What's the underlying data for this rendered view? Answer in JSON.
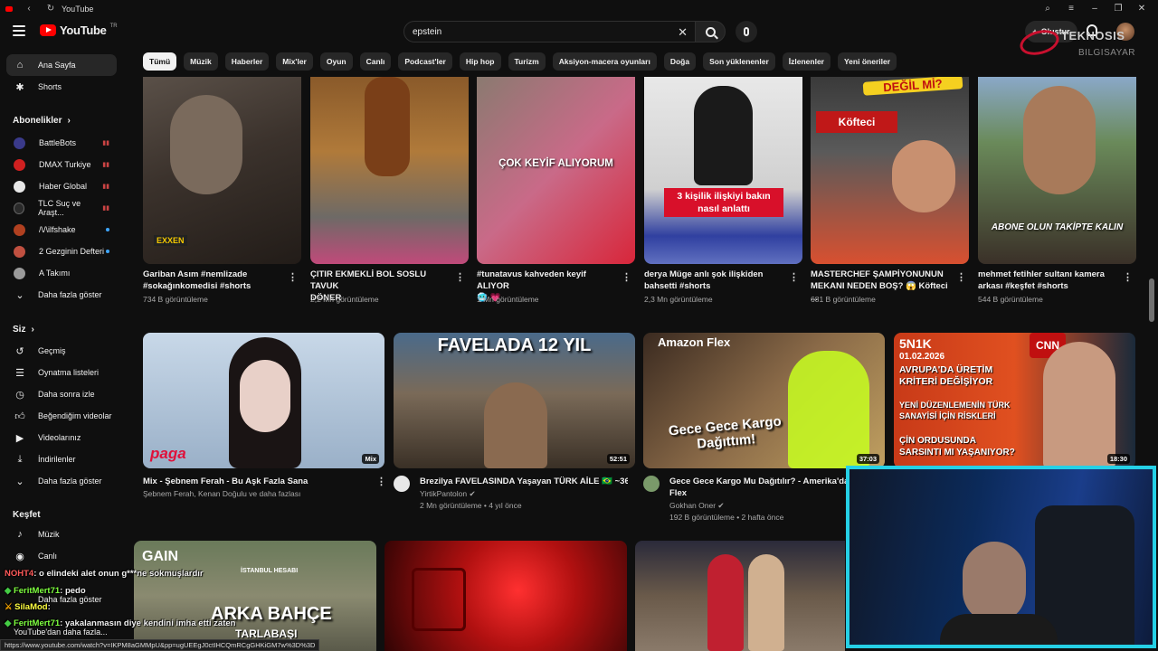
{
  "window": {
    "title": "YouTube"
  },
  "header": {
    "logo_text": "YouTube",
    "logo_region": "TR",
    "search_value": "epstein",
    "create_label": "Oluştur",
    "watermark_line1": "TEKNOSIS",
    "watermark_line2": "BILGISAYAR"
  },
  "sidebar": {
    "home": "Ana Sayfa",
    "shorts": "Shorts",
    "subs_header": "Abonelikler",
    "subscriptions": [
      {
        "name": "BattleBots",
        "color": "#3a3a8a"
      },
      {
        "name": "DMAX Turkiye",
        "color": "#d02020"
      },
      {
        "name": "Haber Global",
        "color": "#e8e8e8"
      },
      {
        "name": "TLC Suç ve Araşt...",
        "color": "#2a2a2a"
      },
      {
        "name": "/\\/\\ilfshake",
        "color": "#b04020"
      },
      {
        "name": "2 Gezginin Defteri",
        "color": "#c05040"
      },
      {
        "name": "A Takımı",
        "color": "#9a9a9a"
      }
    ],
    "subs_more": "Daha fazla göster",
    "you_header": "Siz",
    "you_items": [
      "Geçmiş",
      "Oynatma listeleri",
      "Daha sonra izle",
      "Beğendiğim videolar",
      "Videolarınız",
      "İndirilenler"
    ],
    "you_more": "Daha fazla göster",
    "explore_header": "Keşfet",
    "explore_items": [
      "Müzik",
      "Canlı"
    ],
    "explore_more": "Daha fazla göster",
    "explore_more2": "YouTube'dan daha fazla..."
  },
  "chips": [
    "Tümü",
    "Müzik",
    "Haberler",
    "Mix'ler",
    "Oyun",
    "Canlı",
    "Podcast'ler",
    "Hip hop",
    "Turizm",
    "Aksiyon-macera oyunları",
    "Doğa",
    "Son yüklenenler",
    "İzlenenler",
    "Yeni öneriler"
  ],
  "shorts": [
    {
      "title1": "Gariban Asım #nemlizade",
      "title2": "#sokağınkomedisi #shorts",
      "views": "734 B görüntüleme",
      "overlay": "EXXEN"
    },
    {
      "title1": "ÇITIR EKMEKLİ BOL SOSLU TAVUK",
      "title2": "DÖNER",
      "views": "2,2 Mn görüntüleme",
      "overlay": ""
    },
    {
      "title1": "#tunatavus kahveden keyif ALIYOR",
      "title2": "🥶 💗",
      "views": "1 Mn görüntüleme",
      "overlay": "ÇOK KEYİF ALIYORUM"
    },
    {
      "title1": "derya Müge anlı şok ilişkiden",
      "title2": "bahsetti #shorts",
      "views": "2,3 Mn görüntüleme",
      "overlay": "3 kişilik ilişkiyi bakın nasıl anlattı"
    },
    {
      "title1": "MASTERCHEF ŞAMPİYONUNUN",
      "title2": "MEKANI NEDEN BOŞ? 😱 Köfteci ...",
      "views": "681 B görüntüleme",
      "overlay": "DEĞİL Mİ?"
    },
    {
      "title1": "mehmet fetihler sultanı kamera",
      "title2": "arkası #keşfet #shorts",
      "views": "544 B görüntüleme",
      "overlay": "ABONE OLUN TAKİPTE KALIN"
    }
  ],
  "videos": [
    {
      "title": "Mix - Şebnem Ferah - Bu Aşk Fazla Sana",
      "channel": "Şebnem Ferah, Kenan Doğulu ve daha fazlası",
      "meta": "",
      "badge": "Mix",
      "overlay": "paga"
    },
    {
      "title": "Brezilya FAVELASINDA Yaşayan TÜRK AİLE 🇧🇷 ~365",
      "channel": "YirtikPantolon",
      "meta": "2 Mn görüntüleme • 4 yıl önce",
      "badge": "52:51",
      "overlay": "FAVELADA 12 YIL"
    },
    {
      "title": "Gece Gece Kargo Mu Dağıtılır? - Amerika'da A",
      "title2": "Flex",
      "channel": "Gokhan Oner",
      "meta": "192 B görüntüleme • 2 hafta önce",
      "badge": "37:03",
      "overlay": "Gece Gece Kargo Dağıttım!",
      "overlay2": "Amazon Flex"
    },
    {
      "title": "",
      "channel": "",
      "meta": "",
      "badge": "18:30",
      "overlay": "5N1K",
      "date": "01.02.2026",
      "lines": [
        "AVRUPA'DA ÜRETİM KRİTERİ DEĞİŞİYOR",
        "YENİ DÜZENLEMENİN TÜRK SANAYİSİ İÇİN RİSKLERİ",
        "ÇİN ORDUSUNDA SARSINTI MI YAŞANIYOR?"
      ]
    }
  ],
  "row3": [
    {
      "overlay": "GAIN",
      "overlay2": "ARKA BAHÇE",
      "overlay3": "TARLABAŞI",
      "overlay4": "İSTANBUL HESABI"
    },
    {
      "overlay": ""
    },
    {
      "overlay": ""
    }
  ],
  "chat": [
    {
      "name": "NOHT4",
      "text": ": o elindeki alet onun g***ne sokmuşlardır",
      "mod": false
    },
    {
      "name": "FeritMert71",
      "text": ": pedo",
      "mod": false
    },
    {
      "name": "SilaMod",
      "text": ": ",
      "mod": true
    },
    {
      "name": "FeritMert71",
      "text": ": yakalanmasın diye kendini imha etti zaten",
      "mod": false
    }
  ],
  "status_url": "https://www.youtube.com/watch?v=IKPM8aGMMpU&pp=ugUEEgJ0ctIHCQmRCgGHKiGM7w%3D%3D"
}
